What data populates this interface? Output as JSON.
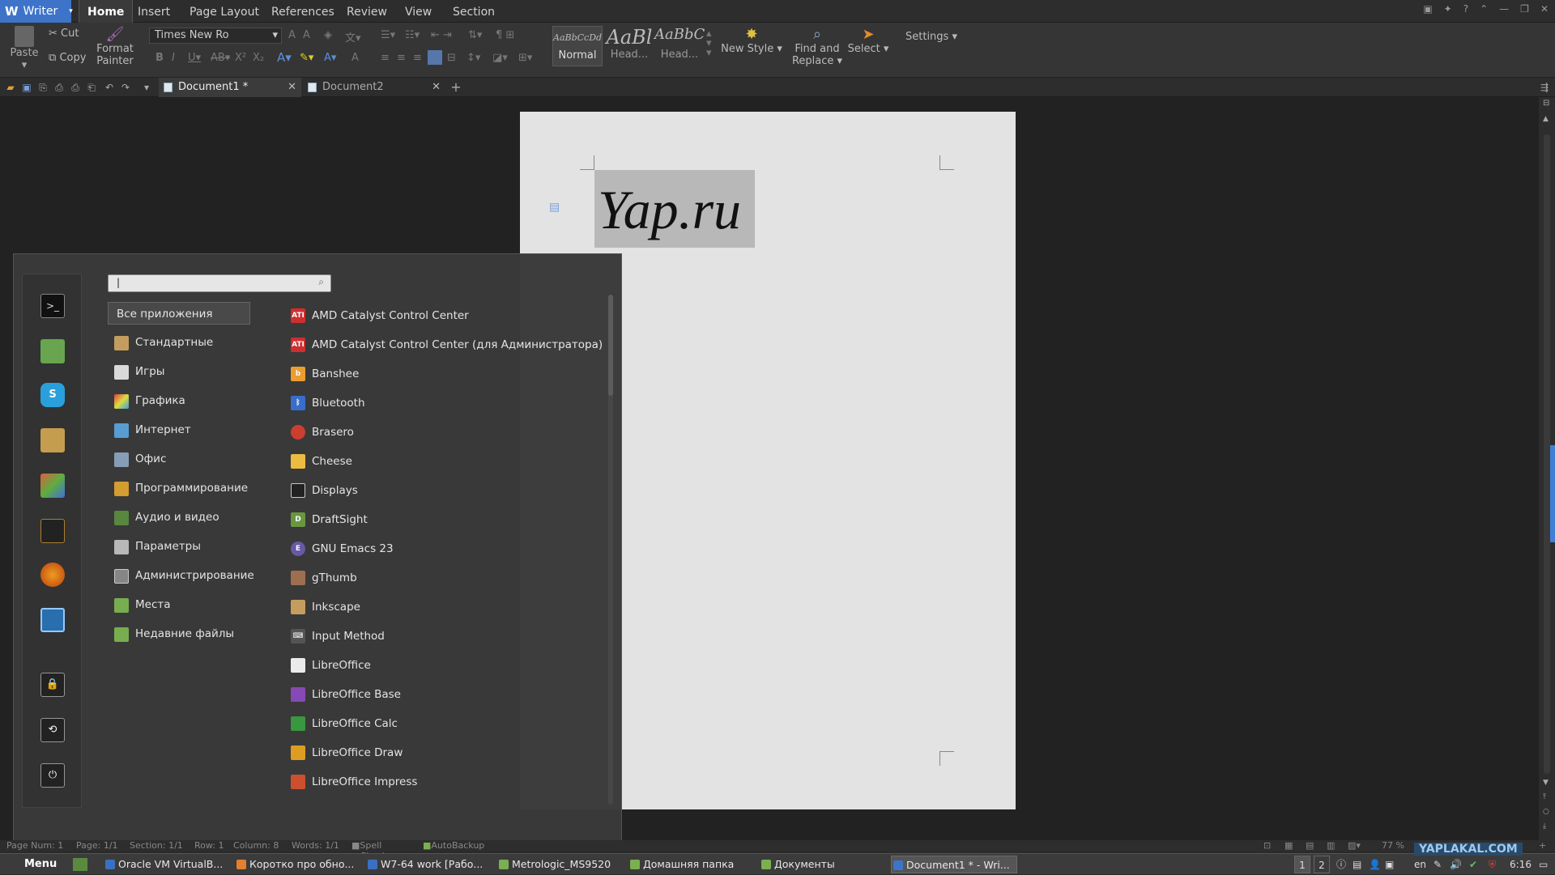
{
  "app": {
    "name": "Writer"
  },
  "ribbon_tabs": [
    "Home",
    "Insert",
    "Page Layout",
    "References",
    "Review",
    "View",
    "Section"
  ],
  "ribbon": {
    "paste": "Paste",
    "cut": "Cut",
    "copy": "Copy",
    "format_painter_line1": "Format",
    "format_painter_line2": "Painter",
    "font_name": "Times New Ro",
    "styles": [
      {
        "preview": "AaBbCcDd",
        "label": "Normal"
      },
      {
        "preview": "AaBl",
        "label": "Head..."
      },
      {
        "preview": "AaBbC",
        "label": "Head..."
      }
    ],
    "new_style": "New Style",
    "find_replace_line1": "Find and",
    "find_replace_line2": "Replace",
    "select": "Select",
    "settings": "Settings"
  },
  "doc_tabs": [
    {
      "title": "Document1 *"
    },
    {
      "title": "Document2"
    }
  ],
  "document": {
    "text": "Yap.ru"
  },
  "start_menu": {
    "search_value": "|",
    "categories": [
      "Все приложения",
      "Стандартные",
      "Игры",
      "Графика",
      "Интернет",
      "Офис",
      "Программирование",
      "Аудио и видео",
      "Параметры",
      "Администрирование",
      "Места",
      "Недавние файлы"
    ],
    "apps": [
      "AMD Catalyst Control Center",
      "AMD Catalyst Control Center (для Администратора)",
      "Banshee",
      "Bluetooth",
      "Brasero",
      "Cheese",
      "Displays",
      "DraftSight",
      "GNU Emacs 23",
      "gThumb",
      "Inkscape",
      "Input Method",
      "LibreOffice",
      "LibreOffice Base",
      "LibreOffice Calc",
      "LibreOffice Draw",
      "LibreOffice Impress"
    ]
  },
  "status": {
    "page_num": "Page Num: 1",
    "page": "Page: 1/1",
    "section": "Section: 1/1",
    "row": "Row: 1",
    "column": "Column: 8",
    "words": "Words: 1/1",
    "spell": "Spell Check",
    "autobackup": "AutoBackup",
    "zoom": "77 %"
  },
  "taskbar": {
    "menu": "Menu",
    "tasks": [
      "Oracle VM VirtualB...",
      "Коротко про обно...",
      "W7-64 work [Рабо...",
      "Metrologic_MS9520",
      "Домашняя папка",
      "Документы",
      "Document1 * - Wri..."
    ],
    "workspaces": [
      "1",
      "2"
    ],
    "lang": "en",
    "time": "6:16",
    "watermark": "YAPLAKAL.COM"
  },
  "colors": {
    "accent": "#3d74c9",
    "amd_red": "#d32f2f"
  }
}
